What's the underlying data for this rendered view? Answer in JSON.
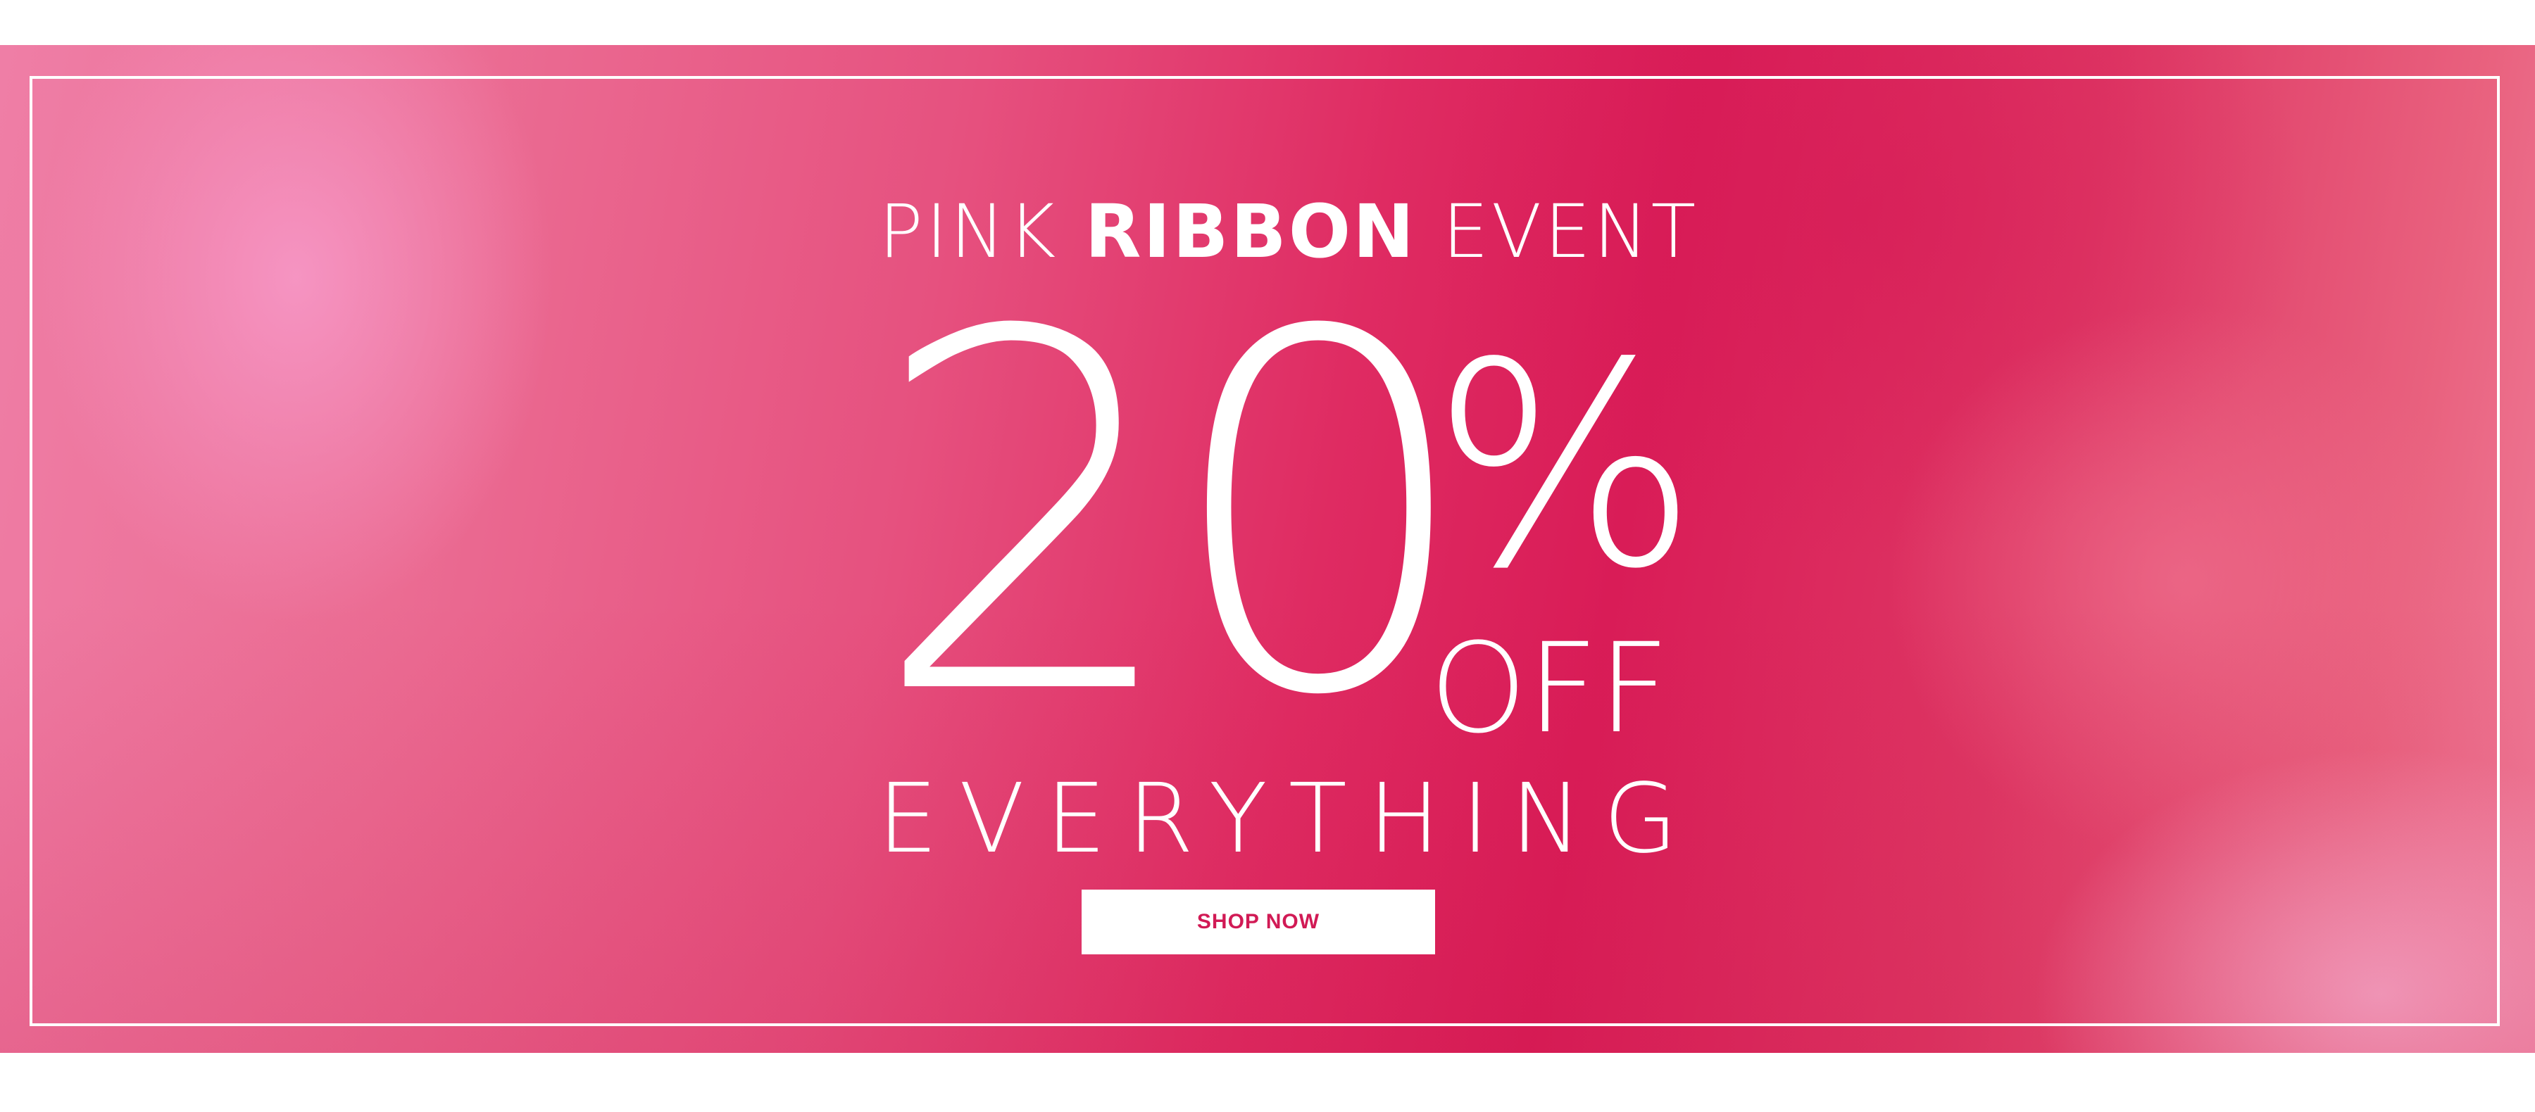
{
  "banner": {
    "headline_part1": "PINK",
    "headline_part2": "RIBBON",
    "headline_part3": "EVENT",
    "discount_number": "20",
    "discount_symbol": "%",
    "discount_suffix": "OFF",
    "subline": "EVERYTHING",
    "cta_label": "SHOP NOW"
  },
  "colors": {
    "background_pink_light": "#ef7ea6",
    "background_pink_deep": "#d91c57",
    "text": "#ffffff",
    "cta_text": "#d11a55",
    "frame": "#ffffff"
  }
}
